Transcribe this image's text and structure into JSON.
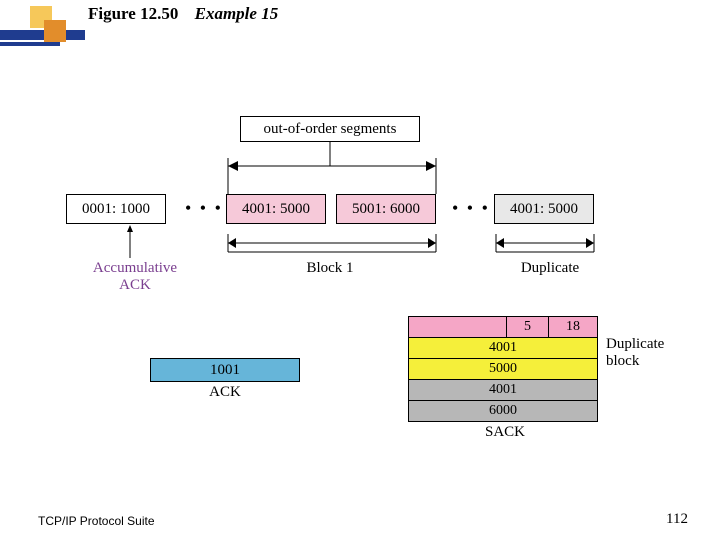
{
  "title": {
    "figure": "Figure 12.50",
    "example": "Example 15"
  },
  "bracket_label": "out-of-order  segments",
  "segments": {
    "s1": "0001: 1000",
    "s2": "4001: 5000",
    "s3": "5001: 6000",
    "s4": "4001: 5000"
  },
  "labels": {
    "accum_ack_l1": "Accumulative",
    "accum_ack_l2": "ACK",
    "block1": "Block 1",
    "duplicate": "Duplicate",
    "dup_block_l1": "Duplicate",
    "dup_block_l2": "block",
    "ack_title": "ACK",
    "sack_title": "SACK"
  },
  "ack_value": "1001",
  "sack_header": {
    "a": "5",
    "b": "18"
  },
  "sack_rows": [
    "4001",
    "5000",
    "4001",
    "6000"
  ],
  "footer": {
    "left": "TCP/IP Protocol Suite",
    "page": "112"
  },
  "dots": "• • •"
}
